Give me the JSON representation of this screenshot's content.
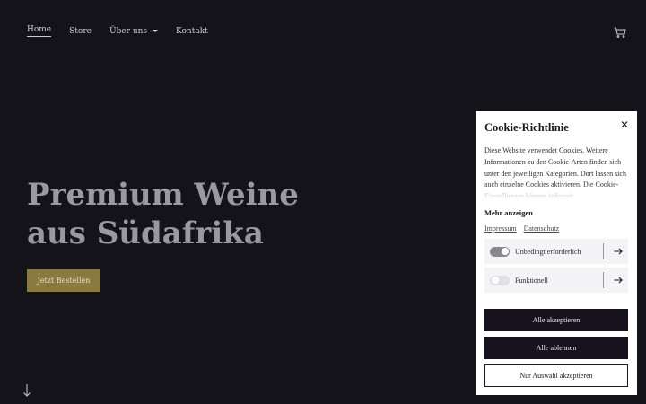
{
  "nav": {
    "items": [
      {
        "label": "Home"
      },
      {
        "label": "Store"
      },
      {
        "label": "Über uns"
      },
      {
        "label": "Kontakt"
      }
    ]
  },
  "header": {
    "cart_icon": "shopping-cart-icon"
  },
  "hero": {
    "title_line1": "Premium Weine",
    "title_line2": "aus Südafrika",
    "cta_label": "Jetzt Bestellen",
    "scroll_icon": "arrow-down-icon"
  },
  "cookie": {
    "title": "Cookie-Richtlinie",
    "close_icon": "close-icon",
    "text": "Diese Website verwendet Cookies. Weitere Informationen zu den Cookie-Arten finden sich unter den jeweiligen Kategorien. Dort lassen sich auch einzelne Cookies aktivieren. Die Cookie-Einstellungen können jederzeit",
    "more_label": "Mehr anzeigen",
    "links": {
      "impressum": "Impressum",
      "datenschutz": "Datenschutz"
    },
    "categories": [
      {
        "label": "Unbedingt erforderlich",
        "enabled": true
      },
      {
        "label": "Funktionell",
        "enabled": false
      }
    ],
    "buttons": {
      "accept_all": "Alle akzeptieren",
      "reject_all": "Alle ablehnen",
      "accept_selection": "Nur Auswahl akzeptieren"
    }
  },
  "colors": {
    "background": "#15131a",
    "accent_gold": "#8b7a40",
    "button_dark": "#17121d"
  }
}
